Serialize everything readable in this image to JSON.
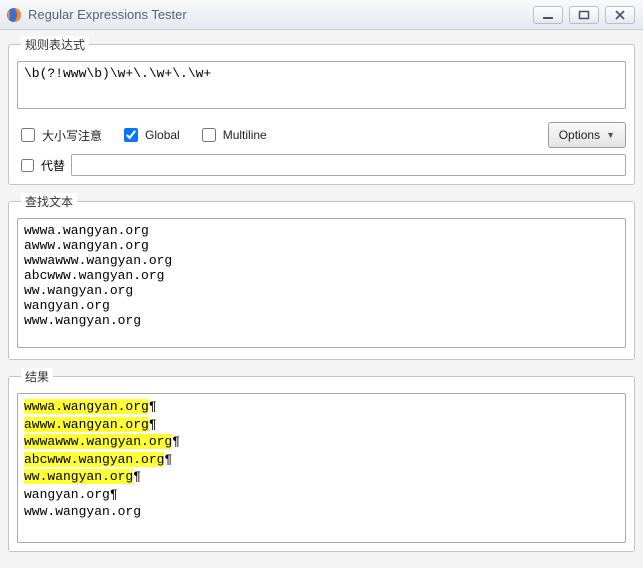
{
  "window": {
    "title": "Regular Expressions Tester"
  },
  "regex": {
    "legend": "规则表达式",
    "value": "\\b(?!www\\b)\\w+\\.\\w+\\.\\w+",
    "case_label": "大小写注意",
    "global_label": "Global",
    "multiline_label": "Multiline",
    "options_label": "Options",
    "substitute_label": "代替",
    "substitute_value": "",
    "case_checked": false,
    "global_checked": true,
    "multiline_checked": false,
    "substitute_checked": false
  },
  "search": {
    "legend": "查找文本",
    "text": "wwwa.wangyan.org\nawww.wangyan.org\nwwwawww.wangyan.org\nabcwww.wangyan.org\nww.wangyan.org\nwangyan.org\nwww.wangyan.org"
  },
  "result": {
    "legend": "结果",
    "lines": [
      {
        "match": "wwwa.wangyan.org",
        "rest": "",
        "pilcrow": true
      },
      {
        "match": "awww.wangyan.org",
        "rest": "",
        "pilcrow": true
      },
      {
        "match": "wwwawww.wangyan.org",
        "rest": "",
        "pilcrow": true
      },
      {
        "match": "abcwww.wangyan.org",
        "rest": "",
        "pilcrow": true
      },
      {
        "match": "ww.wangyan.org",
        "rest": "",
        "pilcrow": true
      },
      {
        "match": "",
        "rest": "wangyan.org",
        "pilcrow": true
      },
      {
        "match": "",
        "rest": "www.wangyan.org",
        "pilcrow": false
      }
    ]
  }
}
